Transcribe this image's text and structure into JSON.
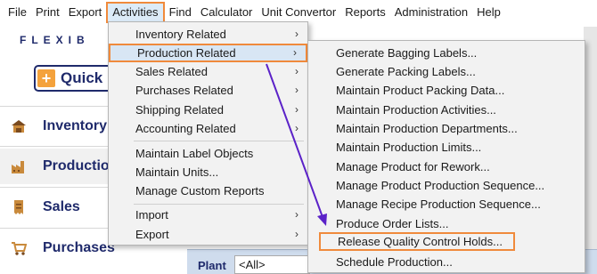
{
  "menubar": {
    "items": [
      "File",
      "Print",
      "Export",
      "Activities",
      "Find",
      "Calculator",
      "Unit Convertor",
      "Reports",
      "Administration",
      "Help"
    ]
  },
  "app": {
    "logo_text": "FLEXIB",
    "quick_label": "Quick",
    "nav": [
      "Inventory",
      "Production",
      "Sales",
      "Purchases"
    ],
    "plant_label": "Plant",
    "plant_value": "<All>"
  },
  "activities_menu": {
    "items": [
      {
        "label": "Inventory Related",
        "submenu": true
      },
      {
        "label": "Production Related",
        "submenu": true
      },
      {
        "label": "Sales Related",
        "submenu": true
      },
      {
        "label": "Purchases Related",
        "submenu": true
      },
      {
        "label": "Shipping Related",
        "submenu": true
      },
      {
        "label": "Accounting Related",
        "submenu": true
      },
      {
        "label": "Maintain Label Objects",
        "submenu": false
      },
      {
        "label": "Maintain Units...",
        "submenu": false
      },
      {
        "label": "Manage Custom Reports",
        "submenu": false
      },
      {
        "label": "Import",
        "submenu": true
      },
      {
        "label": "Export",
        "submenu": true
      }
    ],
    "arrow_glyph": "›"
  },
  "production_menu": {
    "items": [
      "Generate Bagging Labels...",
      "Generate Packing Labels...",
      "Maintain Product Packing Data...",
      "Maintain Production Activities...",
      "Maintain Production Departments...",
      "Maintain Production Limits...",
      "Manage Product for Rework...",
      "Manage Product Production Sequence...",
      "Manage Recipe Production Sequence...",
      "Produce Order Lists...",
      "Release Quality Control Holds...",
      "Schedule Production..."
    ]
  },
  "colors": {
    "highlight_border": "#f08a3c",
    "arrow": "#5b22c8",
    "brand": "#1f2a6b"
  }
}
